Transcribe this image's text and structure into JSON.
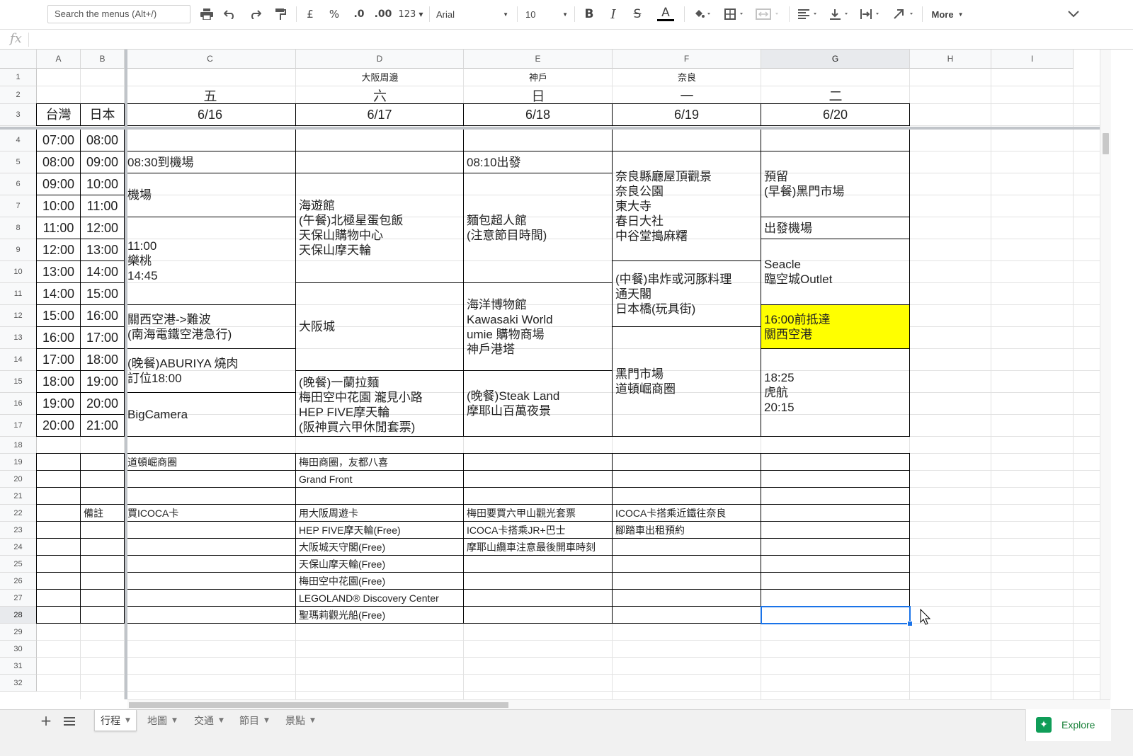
{
  "toolbar": {
    "search_placeholder": "Search the menus (Alt+/)",
    "currency_label": "£",
    "percent_label": "%",
    "dec_decrease_label": ".0",
    "dec_increase_label": ".00",
    "format_label": "123",
    "font_name": "Arial",
    "font_size": "10",
    "bold_label": "B",
    "italic_label": "I",
    "strike_label": "S",
    "textcolor_label": "A",
    "more_label": "More"
  },
  "formula_bar": {
    "fx_label": "fx",
    "value": ""
  },
  "columns": [
    "A",
    "B",
    "C",
    "D",
    "E",
    "F",
    "G",
    "H",
    "I"
  ],
  "rows": [
    "1",
    "2",
    "3",
    "4",
    "5",
    "6",
    "7",
    "8",
    "9",
    "10",
    "11",
    "12",
    "13",
    "14",
    "15",
    "16",
    "17",
    "18",
    "19",
    "20",
    "21",
    "22",
    "23",
    "24",
    "25",
    "26",
    "27",
    "28",
    "29",
    "30",
    "31",
    "32"
  ],
  "sheet": {
    "region": {
      "d": "大阪周邊",
      "e": "神戶",
      "f": "奈良"
    },
    "weekday": {
      "c": "五",
      "d": "六",
      "e": "日",
      "f": "一",
      "g": "二"
    },
    "headers": {
      "a": "台灣",
      "b": "日本",
      "c": "6/16",
      "d": "6/17",
      "e": "6/18",
      "f": "6/19",
      "g": "6/20"
    },
    "times_tw": [
      "07:00",
      "08:00",
      "09:00",
      "10:00",
      "11:00",
      "12:00",
      "13:00",
      "14:00",
      "15:00",
      "16:00",
      "17:00",
      "18:00",
      "19:00",
      "20:00"
    ],
    "times_jp": [
      "08:00",
      "09:00",
      "10:00",
      "11:00",
      "12:00",
      "13:00",
      "14:00",
      "15:00",
      "16:00",
      "17:00",
      "18:00",
      "19:00",
      "20:00",
      "21:00"
    ],
    "schedule": {
      "c5": "08:30到機場",
      "c6": "機場",
      "c8": "11:00\n樂桃\n14:45",
      "c12": "關西空港->難波\n(南海電鐵空港急行)",
      "c14": "(晚餐)ABURIYA 燒肉\n訂位18:00",
      "c16": "BigCamera",
      "d6": "海遊館\n(午餐)北極星蛋包飯\n天保山購物中心\n天保山摩天輪",
      "d11": "大阪城",
      "d15": "(晚餐)一蘭拉麵\n梅田空中花園 瀧見小路\nHEP FIVE摩天輪\n(阪神買六甲休閒套票)",
      "e5": "08:10出發",
      "e6": "麵包超人館\n(注意節目時間)",
      "e11": "海洋博物館\nKawasaki World\numie 購物商場\n神戶港塔",
      "e15": "(晚餐)Steak Land\n摩耶山百萬夜景",
      "f5": "奈良縣廳屋頂觀景\n奈良公園\n東大寺\n春日大社\n中谷堂搗麻糬",
      "f10": "(中餐)串炸或河豚料理\n通天閣\n日本橋(玩具街)",
      "f13": "黑門市場\n道頓崛商圈",
      "g5": "預留\n(早餐)黑門市場",
      "g8": "出發機場",
      "g9": "Seacle\n臨空城Outlet",
      "g12": "16:00前抵達\n關西空港",
      "g14": "18:25\n虎航\n20:15"
    },
    "notes_label": "備註",
    "notes": {
      "c19": "道頓崛商圈",
      "d19": "梅田商圈，友都八喜",
      "d20": "Grand Front",
      "c22": "買ICOCA卡",
      "d22": "用大阪周遊卡",
      "d23": "HEP FIVE摩天輪(Free)",
      "d24": "大阪城天守閣(Free)",
      "d25": "天保山摩天輪(Free)",
      "d26": "梅田空中花園(Free)",
      "d27": "LEGOLAND® Discovery Center",
      "d28": "聖瑪莉觀光船(Free)",
      "e22": "梅田要買六甲山觀光套票",
      "e23": "ICOCA卡搭乘JR+巴士",
      "e24": "摩耶山纜車注意最後開車時刻",
      "f22": "ICOCA卡搭乘近鐵往奈良",
      "f23": "腳踏車出租預約"
    }
  },
  "highlight_color": "#ffff00",
  "selection_color": "#1a73e8",
  "selected_cell": "G28",
  "tabs": [
    "行程",
    "地圖",
    "交通",
    "節目",
    "景點"
  ],
  "active_tab": "行程",
  "explore_label": "Explore"
}
